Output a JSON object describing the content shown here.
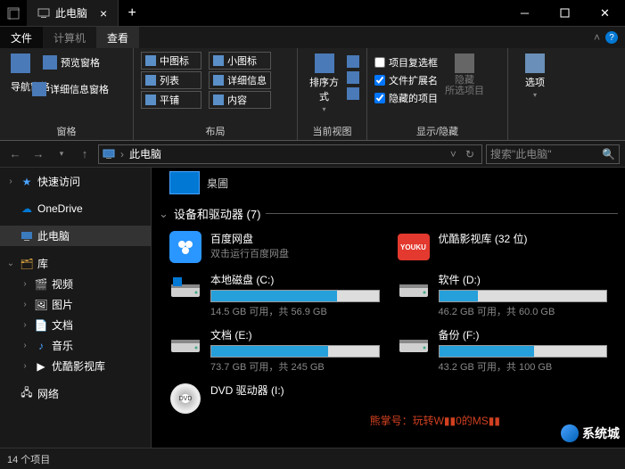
{
  "title": "此电脑",
  "menutabs": {
    "file": "文件",
    "computer": "计算机",
    "view": "查看"
  },
  "ribbon": {
    "panes_group": "窗格",
    "nav_pane": "导航窗格",
    "preview_pane": "预览窗格",
    "details_pane": "详细信息窗格",
    "layout_group": "布局",
    "layout": {
      "medium": "中图标",
      "small": "小图标",
      "list": "列表",
      "details": "详细信息",
      "tiles": "平铺",
      "content": "内容"
    },
    "current_view_group": "当前视图",
    "sort": "排序方式",
    "showhide_group": "显示/隐藏",
    "checks": {
      "checkboxes": "项目复选框",
      "extensions": "文件扩展名",
      "hidden": "隐藏的项目"
    },
    "hide_btn": "隐藏\n所选项目",
    "options": "选项"
  },
  "addressbar": {
    "location": "此电脑",
    "refresh": "↻",
    "search_placeholder": "搜索\"此电脑\""
  },
  "sidebar": {
    "quick": "快速访问",
    "onedrive": "OneDrive",
    "thispc": "此电脑",
    "libraries": "库",
    "videos": "视频",
    "pictures": "图片",
    "documents": "文档",
    "music": "音乐",
    "youku": "优酷影视库",
    "network": "网络"
  },
  "content": {
    "peek_label": "臬圃",
    "section_title": "设备和驱动器 (7)",
    "drives": [
      {
        "name": "百度网盘",
        "sub": "双击运行百度网盘",
        "kind": "baidu"
      },
      {
        "name": "优酷影视库 (32 位)",
        "sub": "",
        "kind": "youku"
      },
      {
        "name": "本地磁盘 (C:)",
        "sub": "14.5 GB 可用，共 56.9 GB",
        "kind": "disk",
        "fill": 75
      },
      {
        "name": "软件 (D:)",
        "sub": "46.2 GB 可用，共 60.0 GB",
        "kind": "disk",
        "fill": 23
      },
      {
        "name": "文档 (E:)",
        "sub": "73.7 GB 可用，共 245 GB",
        "kind": "disk",
        "fill": 70
      },
      {
        "name": "备份 (F:)",
        "sub": "43.2 GB 可用，共 100 GB",
        "kind": "disk",
        "fill": 57
      },
      {
        "name": "DVD 驱动器 (I:)",
        "sub": "",
        "kind": "dvd"
      }
    ]
  },
  "status": "14 个项目",
  "watermark": "系统城",
  "red_banner": "熊掌号：玩转W▮▮0的MS▮▮"
}
